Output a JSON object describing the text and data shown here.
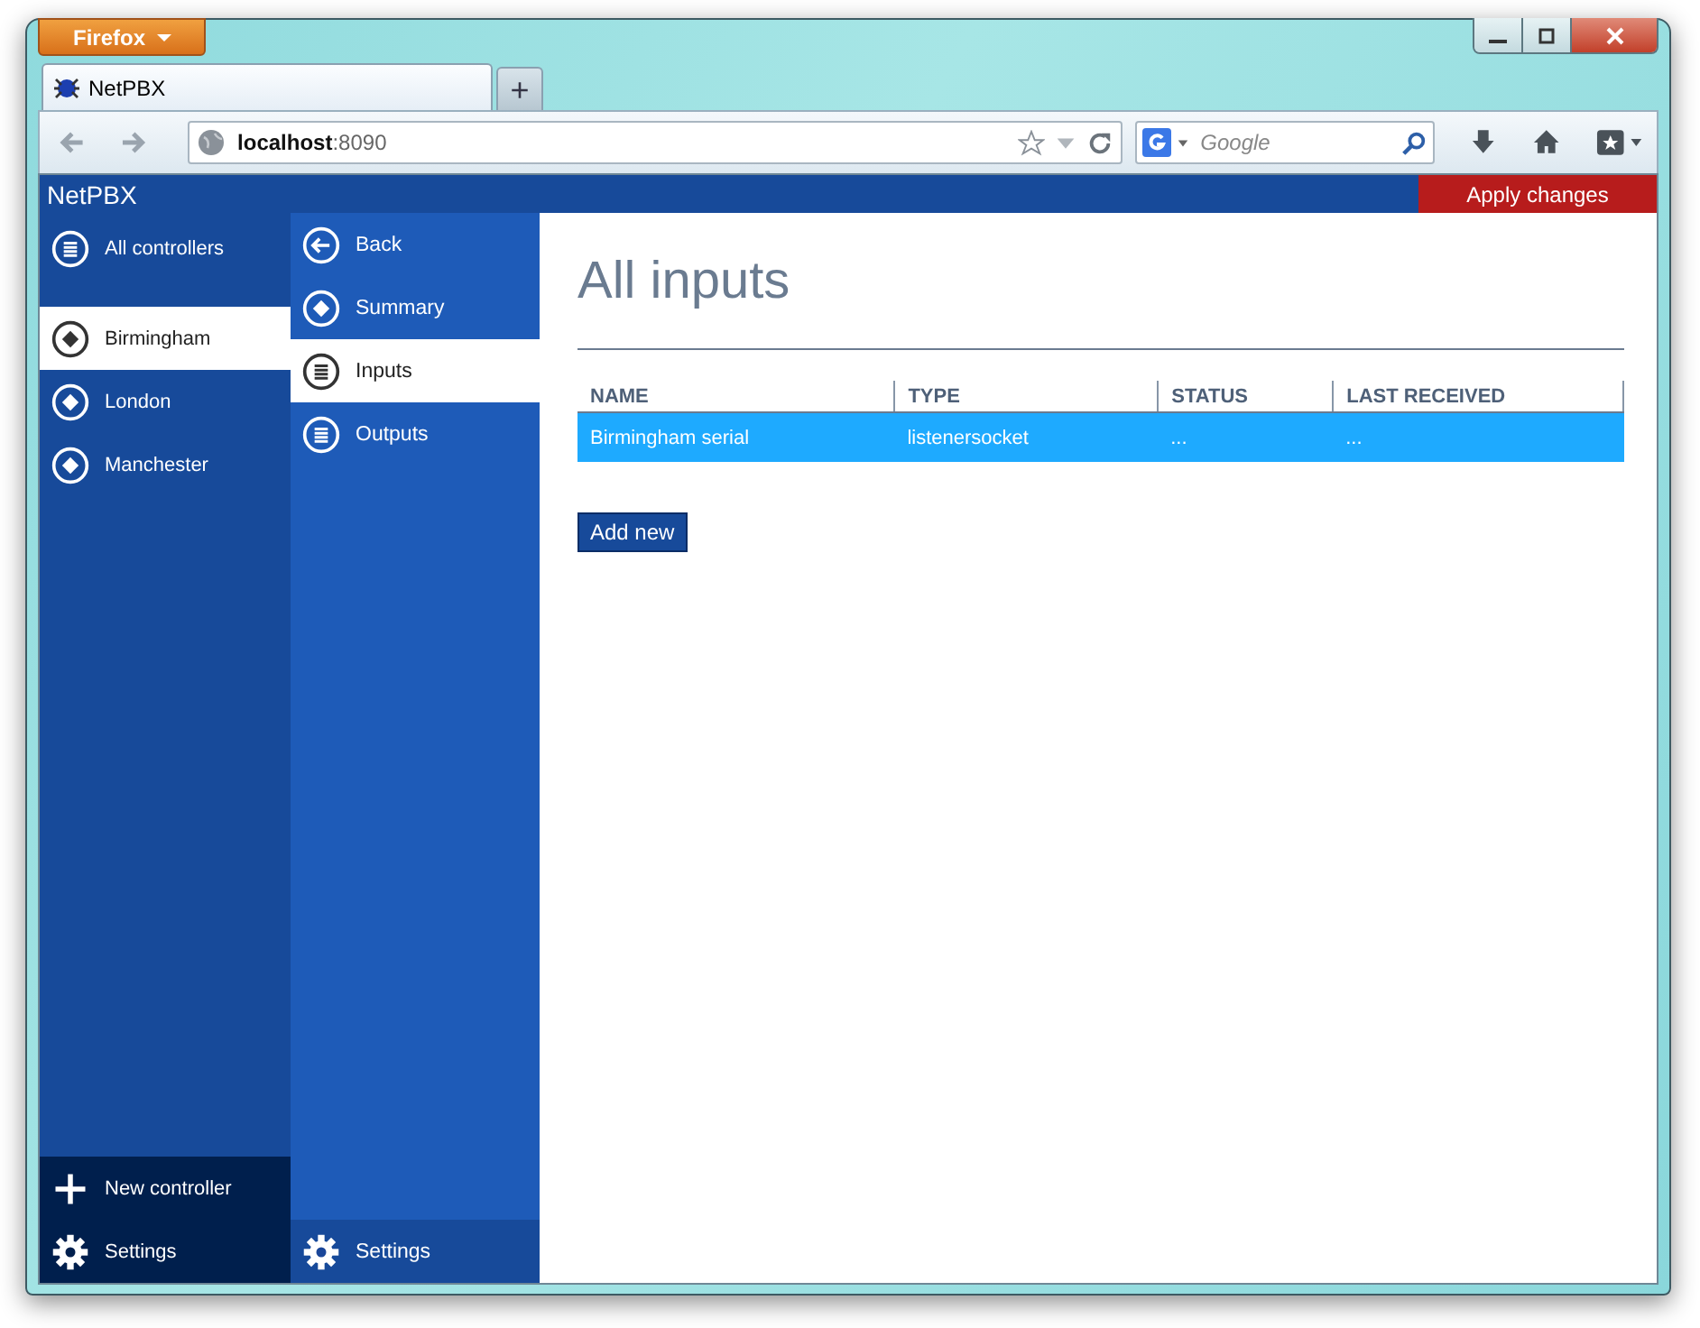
{
  "browser": {
    "menu_button": "Firefox",
    "tabs": [
      {
        "title": "NetPBX",
        "selected": true
      }
    ],
    "new_tab": "+",
    "address": {
      "host": "localhost",
      "port": ":8090"
    },
    "search": {
      "placeholder": "Google"
    }
  },
  "app": {
    "title": "NetPBX",
    "apply_button": "Apply changes"
  },
  "controllers_nav": {
    "header": {
      "label": "All controllers"
    },
    "items": [
      {
        "label": "Birmingham",
        "selected": true
      },
      {
        "label": "London",
        "selected": false
      },
      {
        "label": "Manchester",
        "selected": false
      }
    ],
    "footer": [
      {
        "kind": "add",
        "label": "New controller"
      },
      {
        "kind": "settings",
        "label": "Settings"
      }
    ]
  },
  "section_nav": {
    "items": [
      {
        "kind": "back",
        "label": "Back",
        "selected": false
      },
      {
        "kind": "diamond",
        "label": "Summary",
        "selected": false
      },
      {
        "kind": "list",
        "label": "Inputs",
        "selected": true
      },
      {
        "kind": "list",
        "label": "Outputs",
        "selected": false
      }
    ],
    "footer": {
      "kind": "settings",
      "label": "Settings"
    }
  },
  "page": {
    "title": "All inputs",
    "table": {
      "columns": [
        "NAME",
        "TYPE",
        "STATUS",
        "LAST RECEIVED"
      ],
      "rows": [
        {
          "cells": [
            "Birmingham serial",
            "listenersocket",
            "...",
            "..."
          ],
          "selected": true
        }
      ]
    },
    "add_button": "Add new"
  }
}
